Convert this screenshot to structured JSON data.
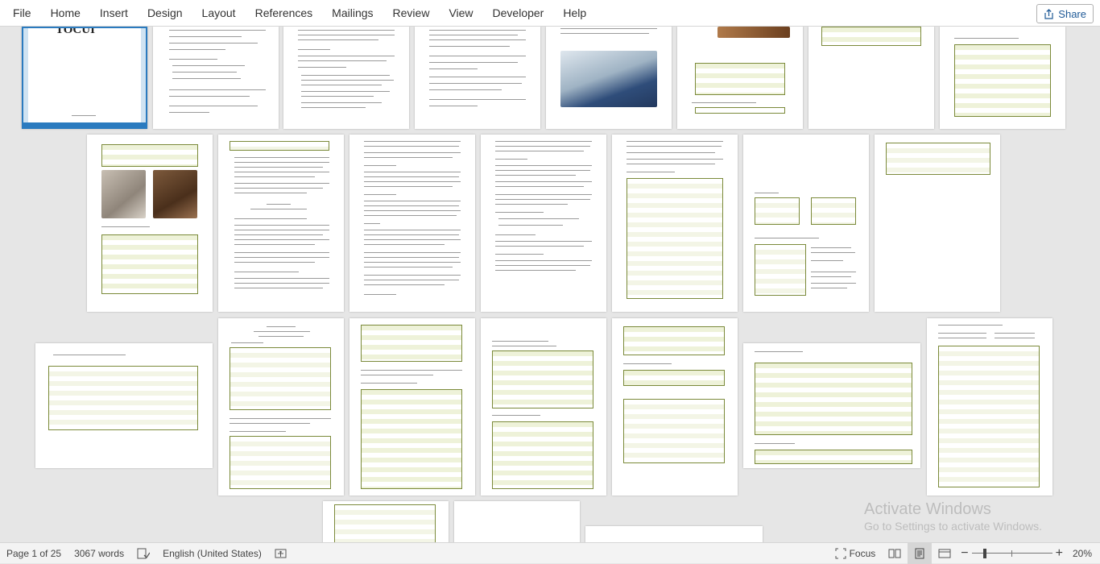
{
  "ribbon": {
    "tabs": [
      "File",
      "Home",
      "Insert",
      "Design",
      "Layout",
      "References",
      "Mailings",
      "Review",
      "View",
      "Developer",
      "Help"
    ],
    "share_label": "Share"
  },
  "status": {
    "page": "Page 1 of 25",
    "words": "3067 words",
    "language": "English (United States)",
    "focus": "Focus",
    "zoom": "20%"
  },
  "watermark": {
    "title": "Activate Windows",
    "subtitle": "Go to Settings to activate Windows."
  },
  "cover_text": "TOCUI"
}
